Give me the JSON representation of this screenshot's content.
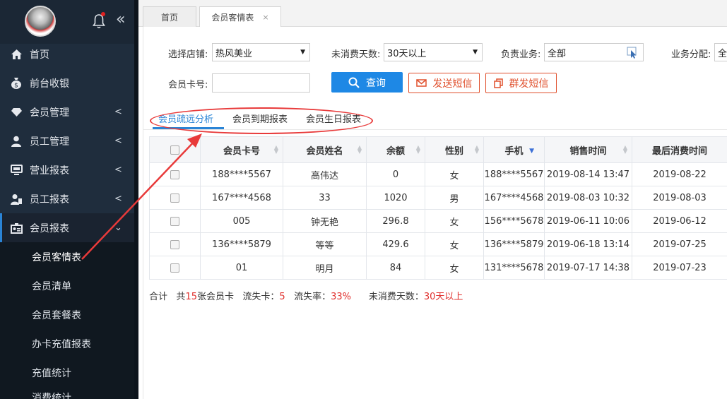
{
  "sidebar": {
    "menu": [
      {
        "label": "首页",
        "icon": "home-icon",
        "has_children": false
      },
      {
        "label": "前台收银",
        "icon": "money-bag-icon",
        "has_children": false
      },
      {
        "label": "会员管理",
        "icon": "diamond-icon",
        "has_children": true
      },
      {
        "label": "员工管理",
        "icon": "user-icon",
        "has_children": true
      },
      {
        "label": "营业报表",
        "icon": "monitor-icon",
        "has_children": true
      },
      {
        "label": "员工报表",
        "icon": "user-report-icon",
        "has_children": true
      },
      {
        "label": "会员报表",
        "icon": "id-card-icon",
        "has_children": true,
        "expanded": true
      }
    ],
    "submenu": [
      "会员客情表",
      "会员清单",
      "会员套餐表",
      "办卡充值报表",
      "充值统计",
      "消费统计"
    ]
  },
  "tabs": {
    "home": "首页",
    "current": "会员客情表",
    "close": "×"
  },
  "filters": {
    "store_label": "选择店铺:",
    "store_value": "热风美业",
    "days_label": "未消费天数:",
    "days_value": "30天以上",
    "staff_label": "负责业务:",
    "staff_value": "全部",
    "assign_label": "业务分配:",
    "assign_value": "全",
    "card_label": "会员卡号:",
    "card_value": ""
  },
  "buttons": {
    "query": "查询",
    "send_sms": "发送短信",
    "mass_sms": "群发短信"
  },
  "subtabs": [
    "会员疏远分析",
    "会员到期报表",
    "会员生日报表"
  ],
  "table": {
    "columns": [
      "会员卡号",
      "会员姓名",
      "余额",
      "性别",
      "手机",
      "销售时间",
      "最后消费时间"
    ],
    "rows": [
      [
        "188****5567",
        "高伟达",
        "0",
        "女",
        "188****5567",
        "2019-08-14 13:47",
        "2019-08-22"
      ],
      [
        "167****4568",
        "33",
        "1020",
        "男",
        "167****4568",
        "2019-08-03 10:32",
        "2019-08-03"
      ],
      [
        "005",
        "钟无艳",
        "296.8",
        "女",
        "156****5678",
        "2019-06-11 10:06",
        "2019-06-12"
      ],
      [
        "136****5879",
        "等等",
        "429.6",
        "女",
        "136****5879",
        "2019-06-18 13:14",
        "2019-07-25"
      ],
      [
        "01",
        "明月",
        "84",
        "女",
        "131****5678",
        "2019-07-17 14:38",
        "2019-07-23"
      ]
    ]
  },
  "summary": {
    "total_label": "合计",
    "count_prefix": "共",
    "count": "15",
    "count_suffix": "张会员卡",
    "lost_label": "流失卡：",
    "lost": "5",
    "rate_label": "流失率：",
    "rate": "33%",
    "days_label": "未消费天数：",
    "days": "30天以上"
  },
  "colors": {
    "sidebar_bg": "#1f2d3d",
    "accent": "#2a84d6",
    "danger": "#e0502d",
    "annotation": "#e83a3a"
  }
}
